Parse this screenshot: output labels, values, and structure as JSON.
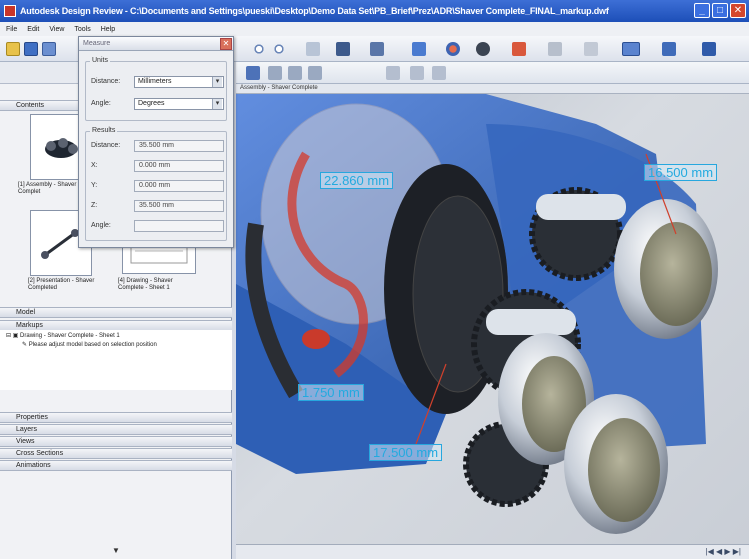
{
  "window": {
    "title": "Autodesk Design Review - C:\\Documents and Settings\\pueski\\Desktop\\Demo Data Set\\PB_Brief\\Prez\\ADR\\Shaver Complete_FINAL_markup.dwf",
    "buttons": {
      "minimize": "_",
      "maximize": "□",
      "close": "✕"
    }
  },
  "menu": {
    "items": [
      "File",
      "Edit",
      "View",
      "Tools",
      "Help"
    ]
  },
  "left_pane": {
    "headers": {
      "contents": "Contents",
      "model": "Model",
      "markups": "Markups",
      "properties": "Properties",
      "layers": "Layers",
      "views": "Views",
      "cross_sections": "Cross Sections",
      "animations": "Animations"
    },
    "thumbnails": [
      {
        "label": "[1] Assembly - Shaver Complet"
      },
      {
        "label": "[2] Presentation - Shaver Completed"
      },
      {
        "label": "[4] Drawing - Shaver Complete - Sheet 1"
      }
    ],
    "markup_tree": {
      "root": "Drawing - Shaver Complete - Sheet 1",
      "child": "Please adjust model based on selection position"
    }
  },
  "dialog": {
    "title": "Measure",
    "close": "✕",
    "units": {
      "title": "Units",
      "distance_label": "Distance:",
      "distance_value": "Millimeters",
      "angle_label": "Angle:",
      "angle_value": "Degrees"
    },
    "results": {
      "title": "Results",
      "rows": [
        {
          "label": "Distance:",
          "value": "35.500 mm"
        },
        {
          "label": "X:",
          "value": "0.000 mm"
        },
        {
          "label": "Y:",
          "value": "0.000 mm"
        },
        {
          "label": "Z:",
          "value": "35.500 mm"
        },
        {
          "label": "Angle:",
          "value": ""
        }
      ]
    }
  },
  "viewport": {
    "tab": "Assembly - Shaver Complete",
    "dimensions": [
      "22.860 mm",
      "16.500 mm",
      "1.750 mm",
      "17.500 mm"
    ],
    "colors": {
      "housing": "#3b6fc7",
      "gear": "#2f3338",
      "dim": "#23aadf"
    }
  }
}
